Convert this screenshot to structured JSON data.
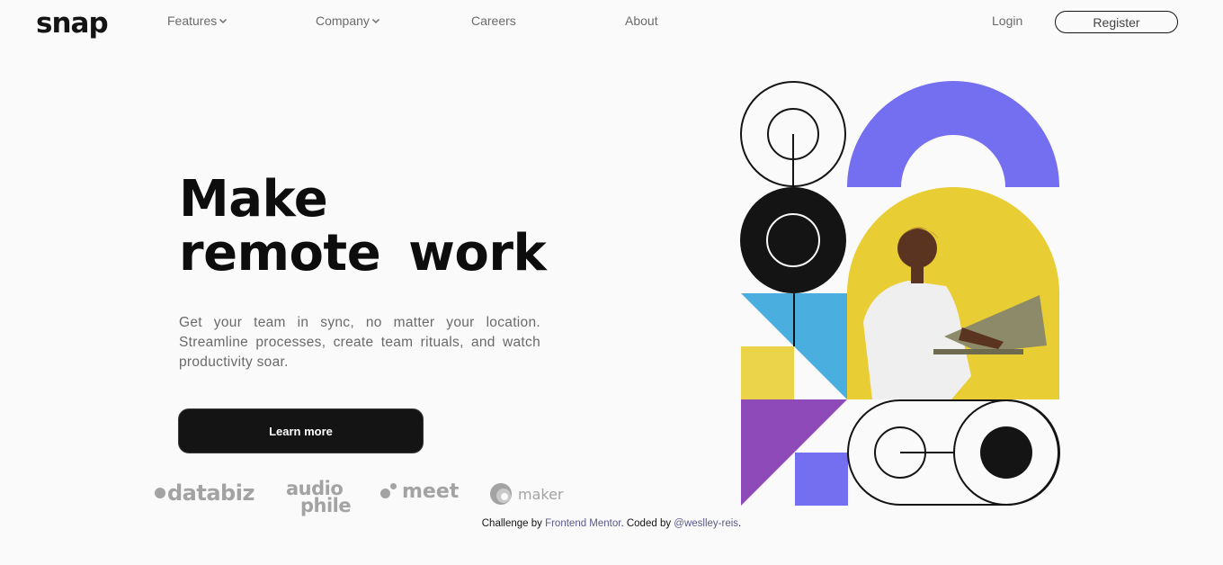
{
  "header": {
    "logo": "snap",
    "nav": [
      {
        "label": "Features",
        "icon": "chevron-down-icon"
      },
      {
        "label": "Company",
        "icon": "chevron-down-icon"
      },
      {
        "label": "Careers"
      },
      {
        "label": "About"
      }
    ],
    "login_label": "Login",
    "register_label": "Register"
  },
  "hero": {
    "title": "Make remote work",
    "description": "Get your team in sync, no matter your location. Streamline processes, create team rituals, and watch productivity soar.",
    "cta_label": "Learn more"
  },
  "clients": [
    {
      "name": "databiz"
    },
    {
      "name": "audio",
      "name2": "phile"
    },
    {
      "name": "meet"
    },
    {
      "name": "maker"
    }
  ],
  "footer": {
    "prefix": "Challenge by ",
    "link1": "Frontend Mentor",
    "middle": ". Coded by ",
    "link2": "@weslley-reis",
    "suffix": "."
  },
  "colors": {
    "background": "#fafafa",
    "text": "#141414",
    "muted": "#6b6b6b",
    "purple": "#746ef0",
    "yellow": "#e8cd35",
    "blue": "#4aaede",
    "violet": "#8d4ab8"
  }
}
